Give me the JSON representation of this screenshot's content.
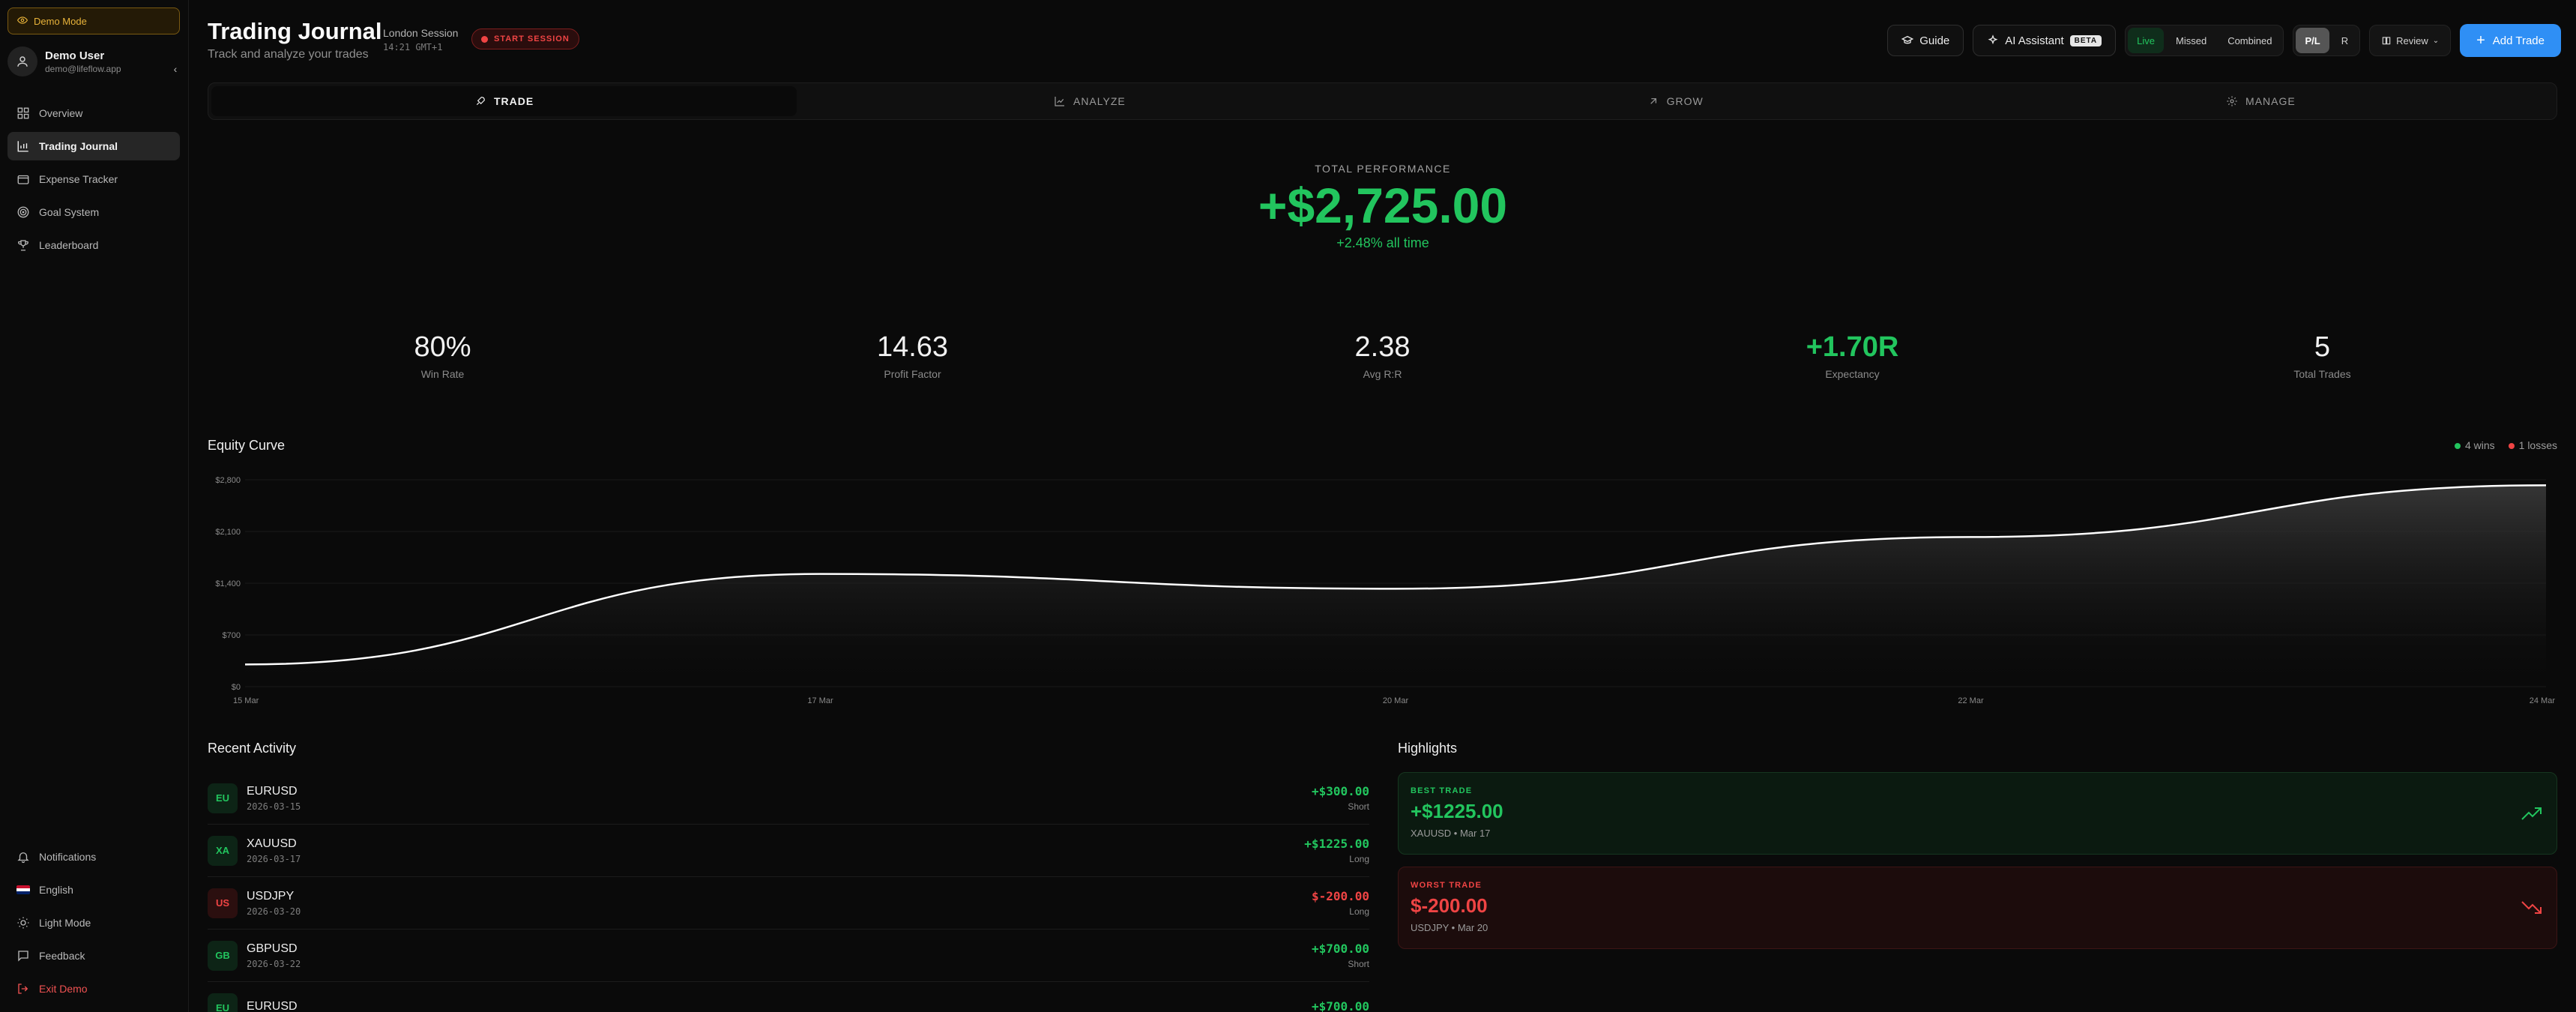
{
  "sidebar": {
    "demo_badge": "Demo Mode",
    "user_name": "Demo User",
    "user_email": "demo@lifeflow.app",
    "nav": [
      {
        "label": "Overview",
        "icon": "grid-icon"
      },
      {
        "label": "Trading Journal",
        "icon": "bar-chart-icon"
      },
      {
        "label": "Expense Tracker",
        "icon": "wallet-icon"
      },
      {
        "label": "Goal System",
        "icon": "target-icon"
      },
      {
        "label": "Leaderboard",
        "icon": "trophy-icon"
      }
    ],
    "bottom": [
      {
        "label": "Notifications",
        "icon": "bell-icon"
      },
      {
        "label": "English",
        "icon": "flag-icon"
      },
      {
        "label": "Light Mode",
        "icon": "sun-icon"
      },
      {
        "label": "Feedback",
        "icon": "message-icon"
      },
      {
        "label": "Exit Demo",
        "icon": "logout-icon"
      }
    ]
  },
  "header": {
    "title": "Trading Journal",
    "subtitle": "Track and analyze your trades",
    "session_name": "London Session",
    "session_time": "14:21 GMT+1",
    "start_session": "START SESSION",
    "guide": "Guide",
    "ai_assistant": "AI Assistant",
    "beta": "BETA",
    "mode_tabs": [
      "Live",
      "Missed",
      "Combined"
    ],
    "unit_tabs": [
      "P/L",
      "R"
    ],
    "review": "Review",
    "add_trade": "Add Trade"
  },
  "tabs": [
    "TRADE",
    "ANALYZE",
    "GROW",
    "MANAGE"
  ],
  "performance": {
    "label": "TOTAL PERFORMANCE",
    "value": "+$2,725.00",
    "pct": "+2.48% all time"
  },
  "stats": [
    {
      "value": "80%",
      "label": "Win Rate"
    },
    {
      "value": "14.63",
      "label": "Profit Factor"
    },
    {
      "value": "2.38",
      "label": "Avg R:R"
    },
    {
      "value": "+1.70R",
      "label": "Expectancy"
    },
    {
      "value": "5",
      "label": "Total Trades"
    }
  ],
  "chart_data": {
    "type": "area",
    "title": "Equity Curve",
    "x_ticks": [
      "15 Mar",
      "17 Mar",
      "20 Mar",
      "22 Mar",
      "24 Mar"
    ],
    "y_ticks": [
      "$0",
      "$700",
      "$1,400",
      "$2,100",
      "$2,800"
    ],
    "ylim": [
      0,
      2800
    ],
    "legend": {
      "wins": "4 wins",
      "losses": "1 losses"
    },
    "series": [
      {
        "values": [
          300,
          1525,
          1325,
          2025,
          2725
        ]
      }
    ]
  },
  "activity": {
    "title": "Recent Activity",
    "rows": [
      {
        "badge": "EU",
        "symbol": "EURUSD",
        "date": "2026-03-15",
        "pnl": "+$300.00",
        "side": "Short",
        "positive": true
      },
      {
        "badge": "XA",
        "symbol": "XAUUSD",
        "date": "2026-03-17",
        "pnl": "+$1225.00",
        "side": "Long",
        "positive": true
      },
      {
        "badge": "US",
        "symbol": "USDJPY",
        "date": "2026-03-20",
        "pnl": "$-200.00",
        "side": "Long",
        "positive": false
      },
      {
        "badge": "GB",
        "symbol": "GBPUSD",
        "date": "2026-03-22",
        "pnl": "+$700.00",
        "side": "Short",
        "positive": true
      },
      {
        "badge": "EU",
        "symbol": "EURUSD",
        "date": "",
        "pnl": "+$700.00",
        "side": "",
        "positive": true
      }
    ]
  },
  "highlights": {
    "title": "Highlights",
    "best": {
      "label": "BEST TRADE",
      "value": "+$1225.00",
      "sub": "XAUUSD • Mar 17"
    },
    "worst": {
      "label": "WORST TRADE",
      "value": "$-200.00",
      "sub": "USDJPY • Mar 20"
    }
  },
  "colors": {
    "green": "#22c55e",
    "red": "#ef4444",
    "accent": "#2f8ff5"
  }
}
